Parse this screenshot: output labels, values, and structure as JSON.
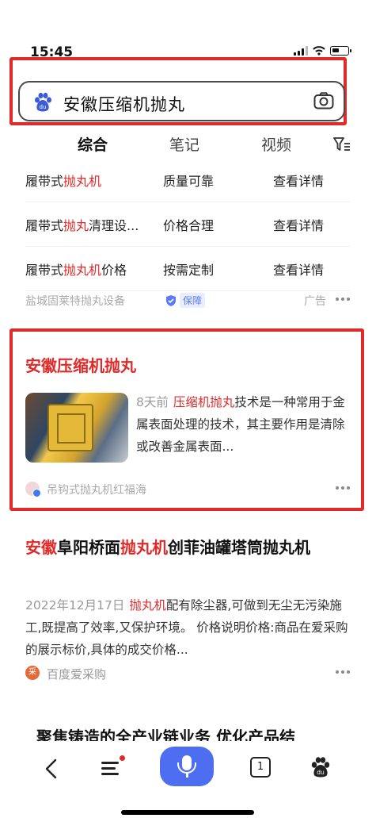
{
  "status": {
    "time": "15:45"
  },
  "search": {
    "query": "安徽压缩机抛丸"
  },
  "tabs": [
    {
      "label": "综合"
    },
    {
      "label": "笔记"
    },
    {
      "label": "视频"
    }
  ],
  "ad": {
    "rows": [
      {
        "prefix": "履带式",
        "hl": "抛丸机",
        "suffix": "",
        "col2": "质量可靠",
        "col3": "查看详情"
      },
      {
        "prefix": "履带式",
        "hl": "抛丸",
        "suffix": "清理设...",
        "col2": "价格合理",
        "col3": "查看详情"
      },
      {
        "prefix": "履带式",
        "hl": "抛丸机",
        "suffix": "价格",
        "col2": "按需定制",
        "col3": "查看详情"
      }
    ],
    "source": "盐城固莱特抛丸设备",
    "guarantee": "保障",
    "label": "广告"
  },
  "result1": {
    "title": "安徽压缩机抛丸",
    "date": "8天前",
    "snippet_hl": "压缩机抛丸",
    "snippet_rest": "技术是一种常用于金属表面处理的技术，其主要作用是清除或改善金属表面...",
    "source": "吊钩式抛丸机红福海"
  },
  "result2": {
    "title_hl1": "安徽",
    "title_mid": "阜阳桥面",
    "title_hl2": "抛丸机",
    "title_rest": "创菲油罐塔筒抛丸机",
    "date": "2022年12月17日",
    "snippet_hl": "抛丸机",
    "snippet_rest": "配有除尘器,可做到无尘无污染施工,既提高了效率,又保护环境。 价格说明价格:商品在爱采购的展示标价,具体的成交价格...",
    "source_icon": "采",
    "source": "百度爱采购"
  },
  "result3": {
    "title_partial": "聚焦铸造的全产业链业务 优化产品结"
  },
  "bottom_nav": {
    "tab_count": "1"
  },
  "colors": {
    "accent": "#4e6ef2",
    "highlight": "#e02a2a"
  }
}
